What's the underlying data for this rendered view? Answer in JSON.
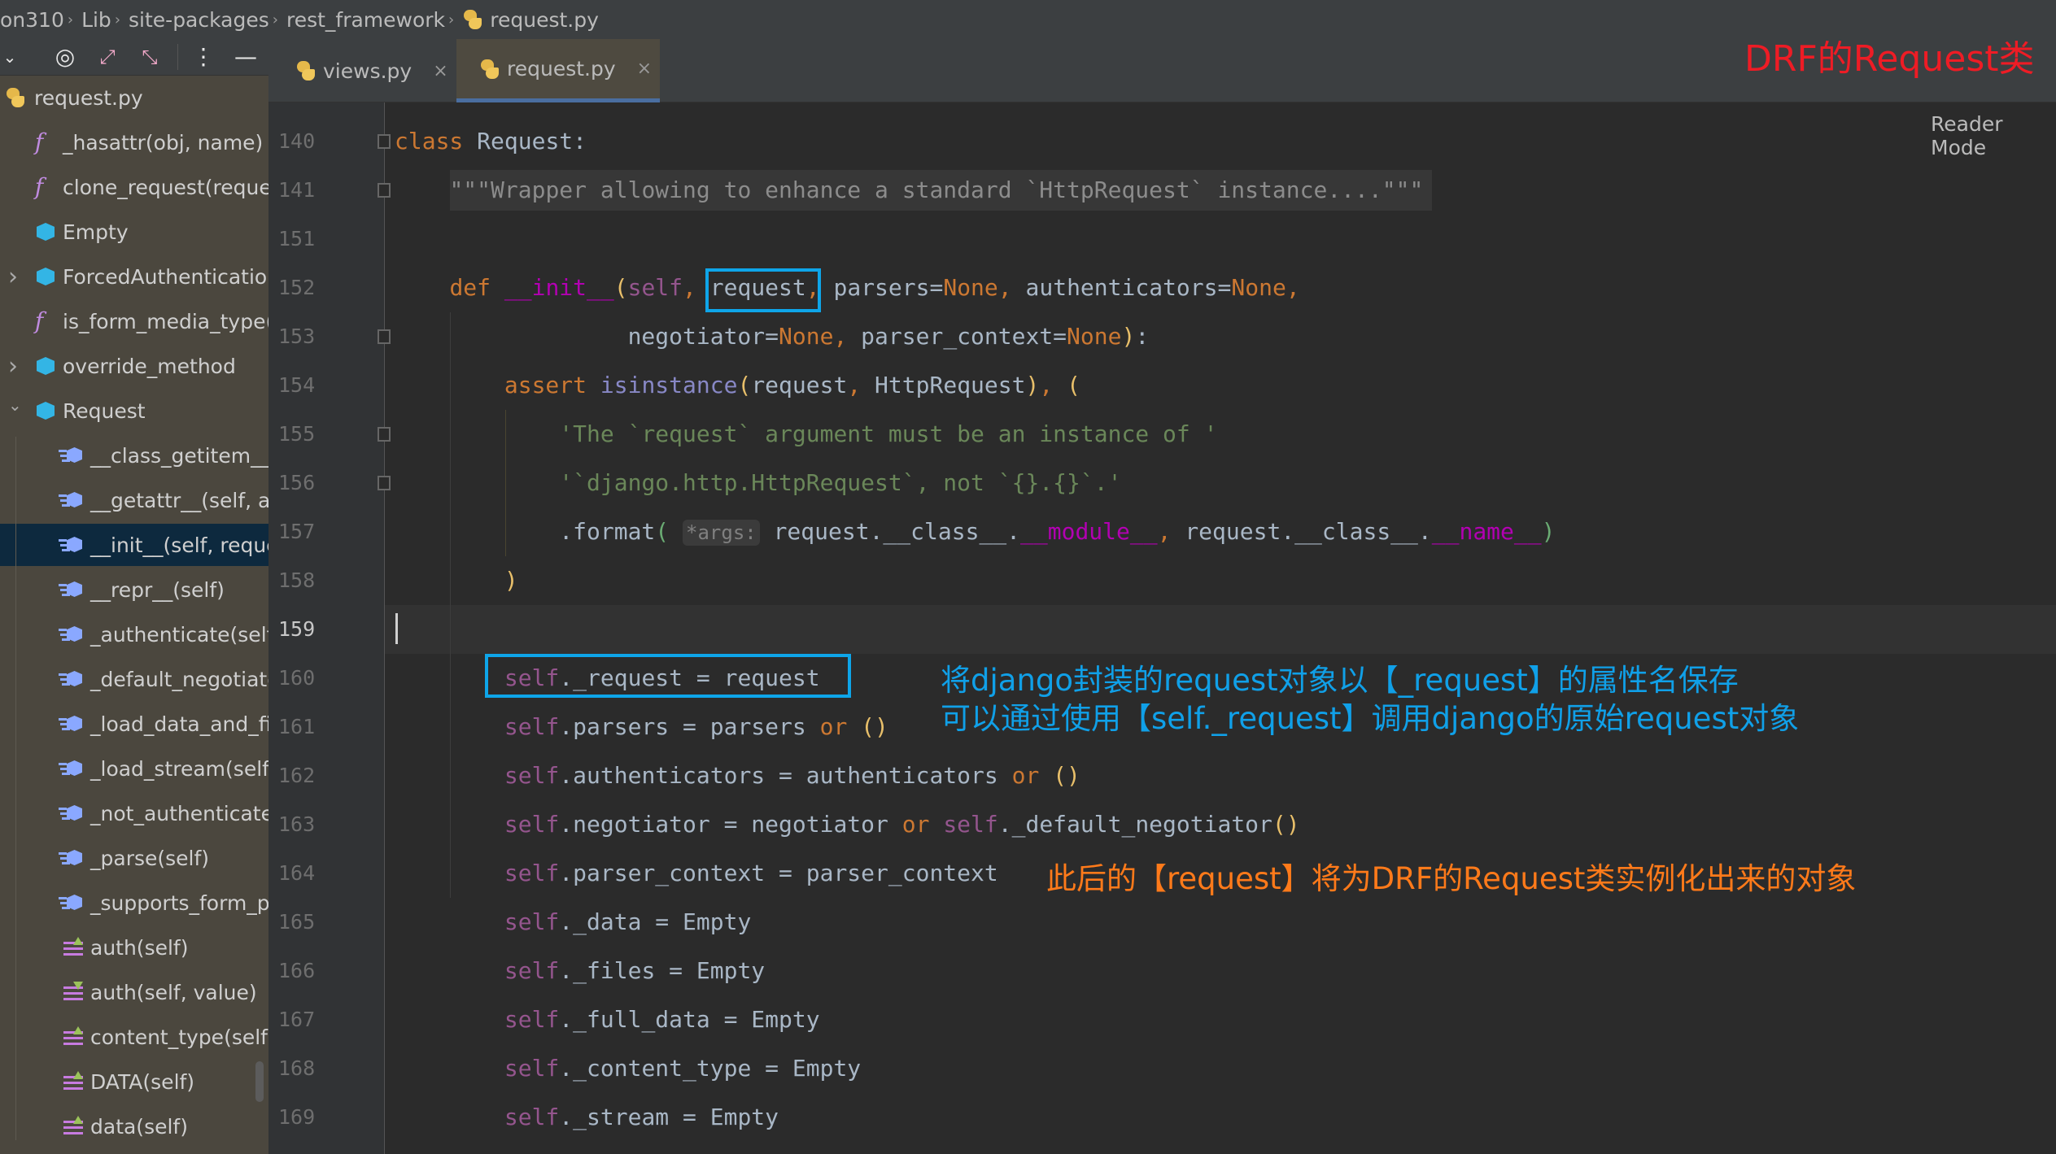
{
  "breadcrumb": [
    "on310",
    "Lib",
    "site-packages",
    "rest_framework",
    "request.py"
  ],
  "toolbar": {
    "icons": [
      "chevron-down-icon",
      "target-icon",
      "expand-icon",
      "collapse-icon",
      "more-icon",
      "minimize-icon"
    ]
  },
  "tabs": [
    {
      "label": "views.py",
      "close": "×",
      "active": false
    },
    {
      "label": "request.py",
      "close": "×",
      "active": true
    }
  ],
  "title_note": "DRF的Request类",
  "reader_mode": "Reader Mode",
  "structure": [
    {
      "label": "request.py",
      "icon": "python-file",
      "level": 0
    },
    {
      "label": "_hasattr(obj, name)",
      "icon": "function",
      "level": 0
    },
    {
      "label": "clone_request(request",
      "icon": "function",
      "level": 0
    },
    {
      "label": "Empty",
      "icon": "class",
      "level": 0
    },
    {
      "label": "ForcedAuthentication",
      "icon": "class",
      "level": 0,
      "expand": "collapsed"
    },
    {
      "label": "is_form_media_type(m",
      "icon": "function",
      "level": 0
    },
    {
      "label": "override_method",
      "icon": "class",
      "level": 0,
      "expand": "collapsed"
    },
    {
      "label": "Request",
      "icon": "class",
      "level": 0,
      "expand": "expanded"
    },
    {
      "label": "__class_getitem__(c",
      "icon": "method",
      "level": 1
    },
    {
      "label": "__getattr__(self, attr",
      "icon": "method",
      "level": 1
    },
    {
      "label": "__init__(self, reques",
      "icon": "method",
      "level": 1,
      "selected": true
    },
    {
      "label": "__repr__(self)",
      "icon": "method",
      "level": 1
    },
    {
      "label": "_authenticate(self)",
      "icon": "method",
      "level": 1
    },
    {
      "label": "_default_negotiator",
      "icon": "method",
      "level": 1
    },
    {
      "label": "_load_data_and_file",
      "icon": "method",
      "level": 1
    },
    {
      "label": "_load_stream(self)",
      "icon": "method",
      "level": 1
    },
    {
      "label": "_not_authenticated",
      "icon": "method",
      "level": 1
    },
    {
      "label": "_parse(self)",
      "icon": "method",
      "level": 1
    },
    {
      "label": "_supports_form_pa",
      "icon": "method",
      "level": 1
    },
    {
      "label": "auth(self)",
      "icon": "property-getter",
      "level": 1
    },
    {
      "label": "auth(self, value)",
      "icon": "property-setter",
      "level": 1
    },
    {
      "label": "content_type(self)",
      "icon": "property-getter",
      "level": 1
    },
    {
      "label": "DATA(self)",
      "icon": "property-getter",
      "level": 1
    },
    {
      "label": "data(self)",
      "icon": "property-getter",
      "level": 1
    }
  ],
  "code": [
    {
      "n": "140",
      "t": [
        [
          "class",
          "kw"
        ],
        [
          " Request:",
          ""
        ]
      ]
    },
    {
      "n": "141",
      "t": [
        [
          "    ",
          ""
        ],
        [
          "\"\"\"Wrapper allowing to enhance a standard `HttpRequest` instance....\"\"\"",
          "dc"
        ]
      ]
    },
    {
      "n": "151",
      "t": []
    },
    {
      "n": "152",
      "t": [
        [
          "    ",
          ""
        ],
        [
          "def",
          "kw"
        ],
        [
          " ",
          ""
        ],
        [
          "__init__",
          "mg"
        ],
        [
          "(",
          "py1"
        ],
        [
          "self",
          "sf"
        ],
        [
          ", ",
          "nn"
        ],
        [
          "request",
          ""
        ],
        [
          ", ",
          "nn"
        ],
        [
          "parsers=",
          ""
        ],
        [
          "None",
          "kw"
        ],
        [
          ", ",
          "nn"
        ],
        [
          "authenticators=",
          ""
        ],
        [
          "None",
          "kw"
        ],
        [
          ",",
          "nn"
        ]
      ]
    },
    {
      "n": "153",
      "t": [
        [
          "                 negotiator=",
          ""
        ],
        [
          "None",
          "kw"
        ],
        [
          ", ",
          "nn"
        ],
        [
          "parser_context=",
          ""
        ],
        [
          "None",
          "kw"
        ],
        [
          ")",
          "py1"
        ],
        [
          ":",
          ""
        ]
      ]
    },
    {
      "n": "154",
      "t": [
        [
          "        ",
          ""
        ],
        [
          "assert",
          "kw"
        ],
        [
          " ",
          ""
        ],
        [
          "isinstance",
          "bi"
        ],
        [
          "(",
          "py1"
        ],
        [
          "request",
          ""
        ],
        [
          ", ",
          "nn"
        ],
        [
          "HttpRequest",
          ""
        ],
        [
          ")",
          "py1"
        ],
        [
          ", ",
          "nn"
        ],
        [
          "(",
          "py1"
        ]
      ]
    },
    {
      "n": "155",
      "t": [
        [
          "            ",
          ""
        ],
        [
          "'The `request` argument must be an instance of '",
          "st"
        ]
      ]
    },
    {
      "n": "156",
      "t": [
        [
          "            ",
          ""
        ],
        [
          "'`django.http.HttpRequest`, not `{}.{}`.'",
          "st"
        ]
      ]
    },
    {
      "n": "157",
      "t": [
        [
          "            .format",
          ""
        ],
        [
          "(",
          "py2"
        ],
        [
          " ",
          ""
        ],
        [
          "*args:",
          "hint"
        ],
        [
          " request.__class__.",
          ""
        ],
        [
          "__module__",
          "mg"
        ],
        [
          ", ",
          "nn"
        ],
        [
          "request.__class__.",
          ""
        ],
        [
          "__name__",
          "mg"
        ],
        [
          ")",
          "py2"
        ]
      ]
    },
    {
      "n": "158",
      "t": [
        [
          "        ",
          ""
        ],
        [
          ")",
          "py1"
        ]
      ]
    },
    {
      "n": "159",
      "t": [],
      "current": true
    },
    {
      "n": "160",
      "t": [
        [
          "        ",
          ""
        ],
        [
          "self",
          "sf"
        ],
        [
          "._request = request",
          ""
        ]
      ]
    },
    {
      "n": "161",
      "t": [
        [
          "        ",
          ""
        ],
        [
          "self",
          "sf"
        ],
        [
          ".parsers = parsers ",
          ""
        ],
        [
          "or",
          "kw"
        ],
        [
          " ",
          ""
        ],
        [
          "()",
          "py1"
        ]
      ]
    },
    {
      "n": "162",
      "t": [
        [
          "        ",
          ""
        ],
        [
          "self",
          "sf"
        ],
        [
          ".authenticators = authenticators ",
          ""
        ],
        [
          "or",
          "kw"
        ],
        [
          " ",
          ""
        ],
        [
          "()",
          "py1"
        ]
      ]
    },
    {
      "n": "163",
      "t": [
        [
          "        ",
          ""
        ],
        [
          "self",
          "sf"
        ],
        [
          ".negotiator = negotiator ",
          ""
        ],
        [
          "or",
          "kw"
        ],
        [
          " ",
          ""
        ],
        [
          "self",
          "sf"
        ],
        [
          "._default_negotiator",
          ""
        ],
        [
          "()",
          "py1"
        ]
      ]
    },
    {
      "n": "164",
      "t": [
        [
          "        ",
          ""
        ],
        [
          "self",
          "sf"
        ],
        [
          ".parser_context = parser_context",
          ""
        ]
      ]
    },
    {
      "n": "165",
      "t": [
        [
          "        ",
          ""
        ],
        [
          "self",
          "sf"
        ],
        [
          "._data = Empty",
          ""
        ]
      ]
    },
    {
      "n": "166",
      "t": [
        [
          "        ",
          ""
        ],
        [
          "self",
          "sf"
        ],
        [
          "._files = Empty",
          ""
        ]
      ]
    },
    {
      "n": "167",
      "t": [
        [
          "        ",
          ""
        ],
        [
          "self",
          "sf"
        ],
        [
          "._full_data = Empty",
          ""
        ]
      ]
    },
    {
      "n": "168",
      "t": [
        [
          "        ",
          ""
        ],
        [
          "self",
          "sf"
        ],
        [
          "._content_type = Empty",
          ""
        ]
      ]
    },
    {
      "n": "169",
      "t": [
        [
          "        ",
          ""
        ],
        [
          "self",
          "sf"
        ],
        [
          "._stream = Empty",
          ""
        ]
      ]
    }
  ],
  "annotations": {
    "blue_line1": "将django封装的request对象以【_request】的属性名保存",
    "blue_line2": "可以通过使用【self._request】调用django的原始request对象",
    "orange": "此后的【request】将为DRF的Request类实例化出来的对象"
  },
  "colors": {
    "annotation_blue": "#10a0e8",
    "annotation_orange": "#ff7a1a",
    "title_red": "#ee1c25",
    "highlight_box": "#0ea5e9"
  }
}
